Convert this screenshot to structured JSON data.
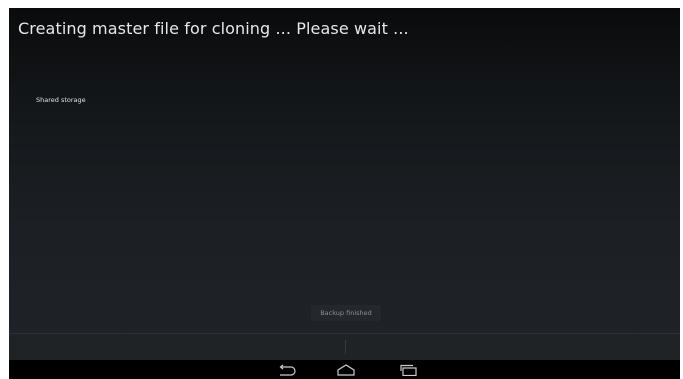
{
  "header": {
    "title": "Creating master file for cloning ... Please wait ..."
  },
  "storage": {
    "label": "Shared storage"
  },
  "toast": {
    "message": "Backup finished"
  },
  "navbar": {
    "icons": [
      "back-icon",
      "home-icon",
      "recents-icon"
    ]
  },
  "colors": {
    "background": "#15181b",
    "text": "#e8e8e8",
    "navbar": "#000000"
  }
}
